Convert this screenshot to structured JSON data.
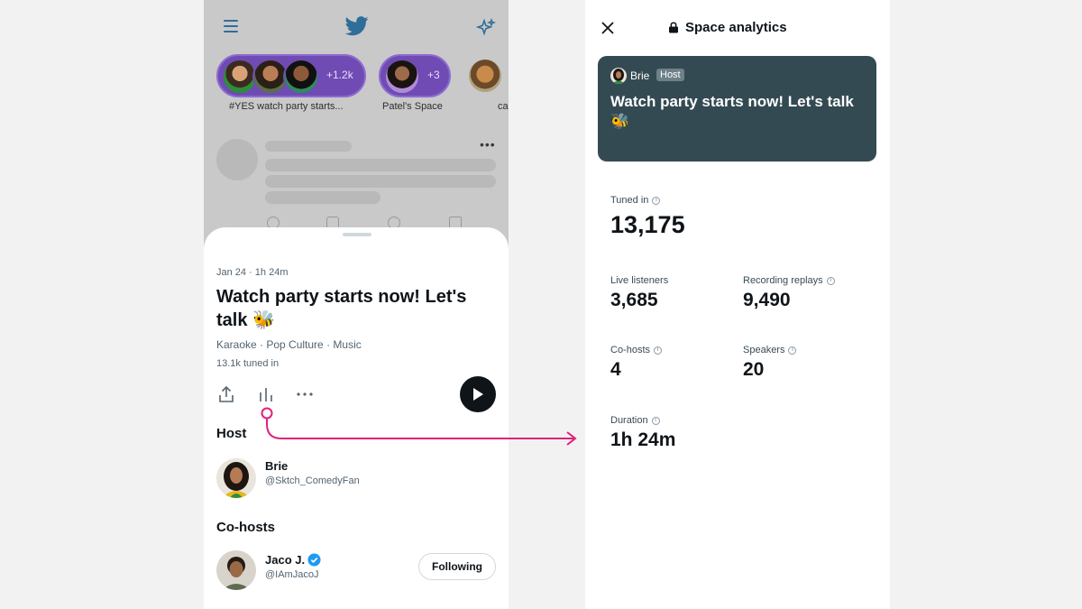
{
  "feed": {
    "spaces": [
      {
        "caption": "#YES watch party starts...",
        "count": "+1.2k"
      },
      {
        "caption": "Patel's Space",
        "count": "+3"
      },
      {
        "caption": "ca"
      }
    ]
  },
  "space_sheet": {
    "date": "Jan 24 · 1h 24m",
    "title": "Watch party starts now! Let's talk 🐝",
    "topics": "Karaoke · Pop Culture · Music",
    "tuned_in": "13.1k tuned in",
    "host_heading": "Host",
    "host": {
      "name": "Brie",
      "handle": "@Sktch_ComedyFan"
    },
    "cohosts_heading": "Co-hosts",
    "cohost": {
      "name": "Jaco J.",
      "handle": "@IAmJacoJ",
      "follow_label": "Following"
    }
  },
  "analytics": {
    "title": "Space analytics",
    "card": {
      "host_name": "Brie",
      "host_badge": "Host",
      "title": "Watch party starts now! Let's talk 🐝"
    },
    "tuned_in": {
      "label": "Tuned in",
      "value": "13,175"
    },
    "live_listeners": {
      "label": "Live listeners",
      "value": "3,685"
    },
    "recording_replays": {
      "label": "Recording replays",
      "value": "9,490"
    },
    "cohosts": {
      "label": "Co-hosts",
      "value": "4"
    },
    "speakers": {
      "label": "Speakers",
      "value": "20"
    },
    "duration": {
      "label": "Duration",
      "value": "1h 24m"
    }
  },
  "colors": {
    "twitter_blue": "#1d9bf0",
    "spaces_purple": "#6f4bb3",
    "card_bg": "#344a52",
    "connector_pink": "#e0217a"
  }
}
